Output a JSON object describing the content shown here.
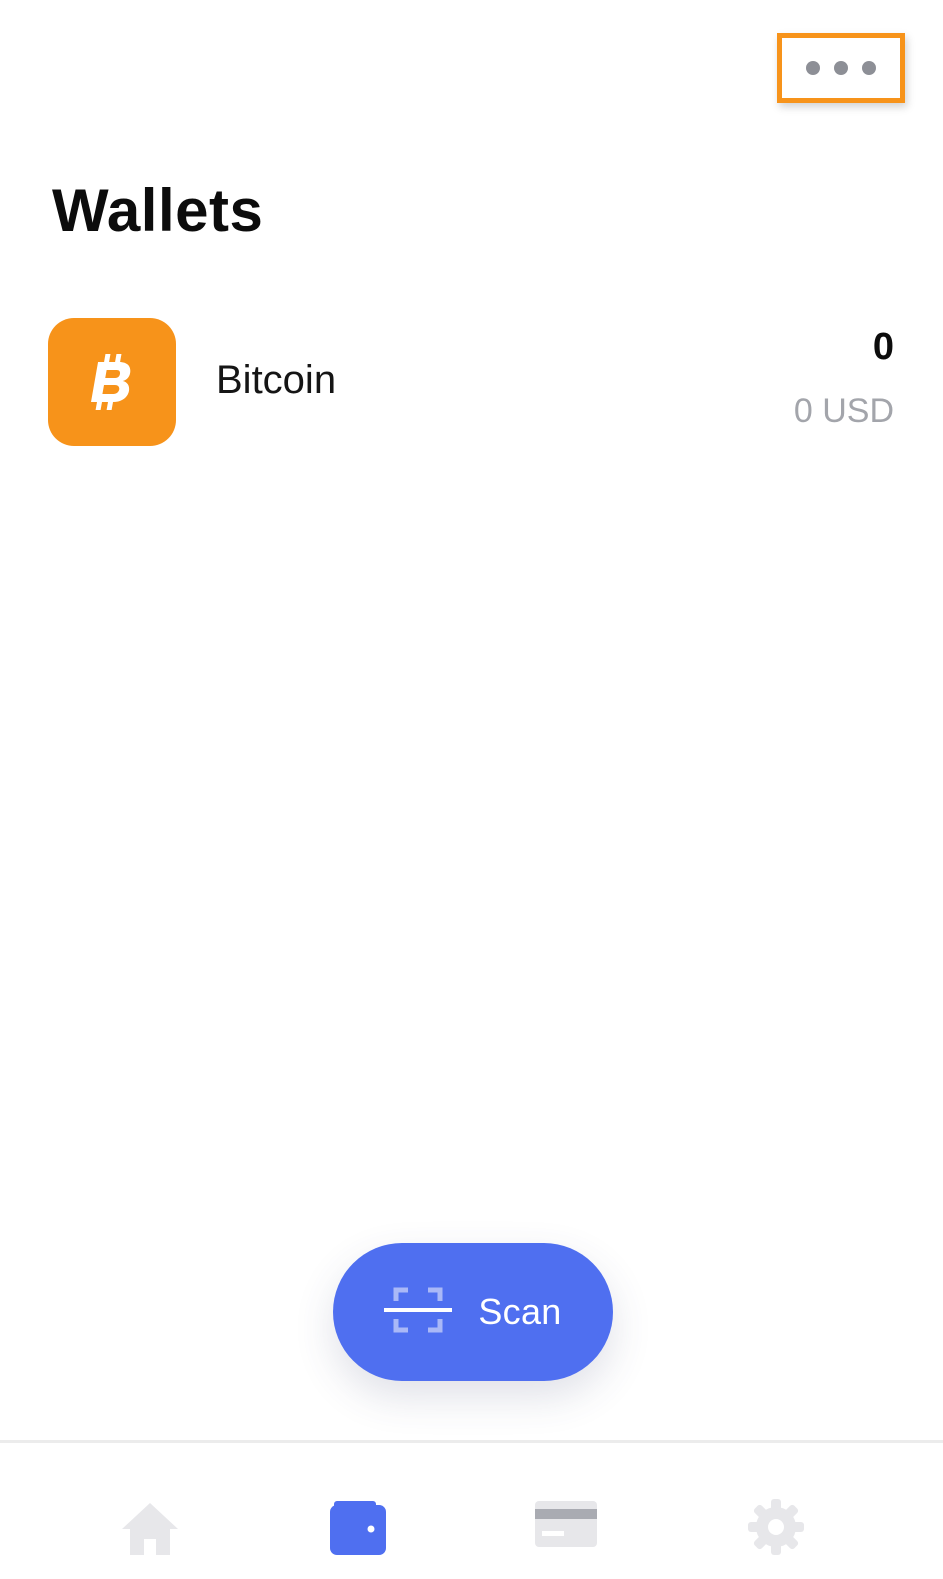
{
  "header": {
    "more_icon": "more-horizontal-icon",
    "title": "Wallets"
  },
  "wallets": [
    {
      "name": "Bitcoin",
      "icon": "bitcoin-icon",
      "balance": "0",
      "fiat": "0 USD"
    }
  ],
  "scan": {
    "label": "Scan",
    "icon": "scan-icon"
  },
  "tabs": [
    {
      "name": "home",
      "icon": "home-icon",
      "active": false
    },
    {
      "name": "wallets",
      "icon": "wallet-icon",
      "active": true
    },
    {
      "name": "cards",
      "icon": "card-icon",
      "active": false
    },
    {
      "name": "settings",
      "icon": "gear-icon",
      "active": false
    }
  ],
  "colors": {
    "accent": "#4f6ff0",
    "bitcoin": "#f7931a",
    "highlight": "#f7931a",
    "inactive_tab": "#e7e7ea",
    "muted_text": "#a3a5ab"
  }
}
